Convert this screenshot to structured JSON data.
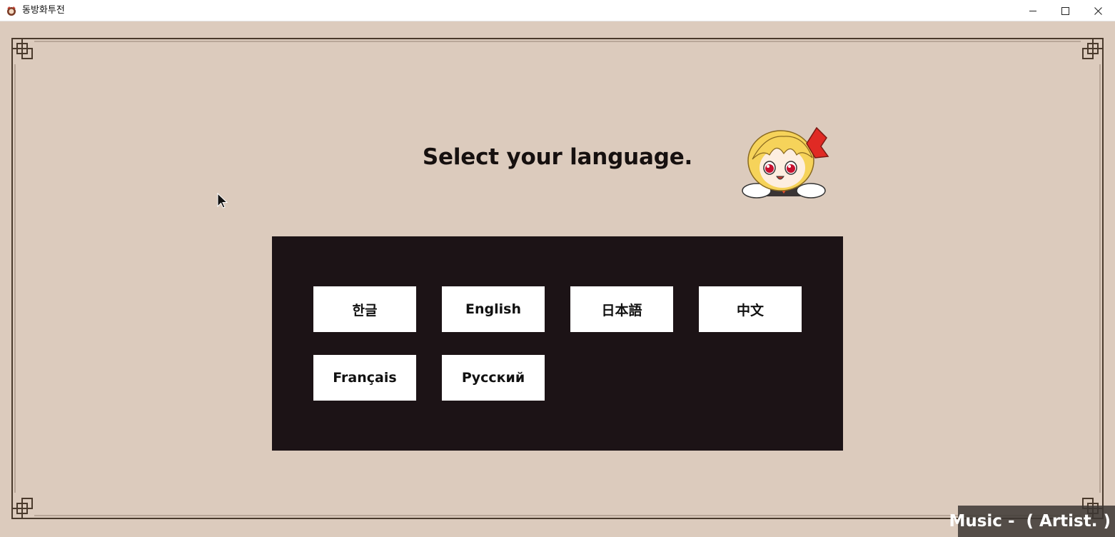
{
  "window": {
    "title": "동방화투전",
    "app_icon": "app-icon",
    "controls": {
      "minimize_icon": "minimize-icon",
      "maximize_icon": "maximize-icon",
      "close_icon": "close-icon"
    }
  },
  "screen": {
    "heading": "Select your language.",
    "mascot": "chibi-character-icon",
    "languages": [
      {
        "label": "한글"
      },
      {
        "label": "English"
      },
      {
        "label": "日本語"
      },
      {
        "label": "中文"
      },
      {
        "label": "Français"
      },
      {
        "label": "Русский"
      }
    ]
  },
  "music": {
    "text": "Music -  ( Artist. )"
  },
  "colors": {
    "background": "#dccbbd",
    "frame": "#4a3a2c",
    "panel": "#1c1316",
    "button": "#ffffff",
    "music_bar": "#3c3734"
  }
}
